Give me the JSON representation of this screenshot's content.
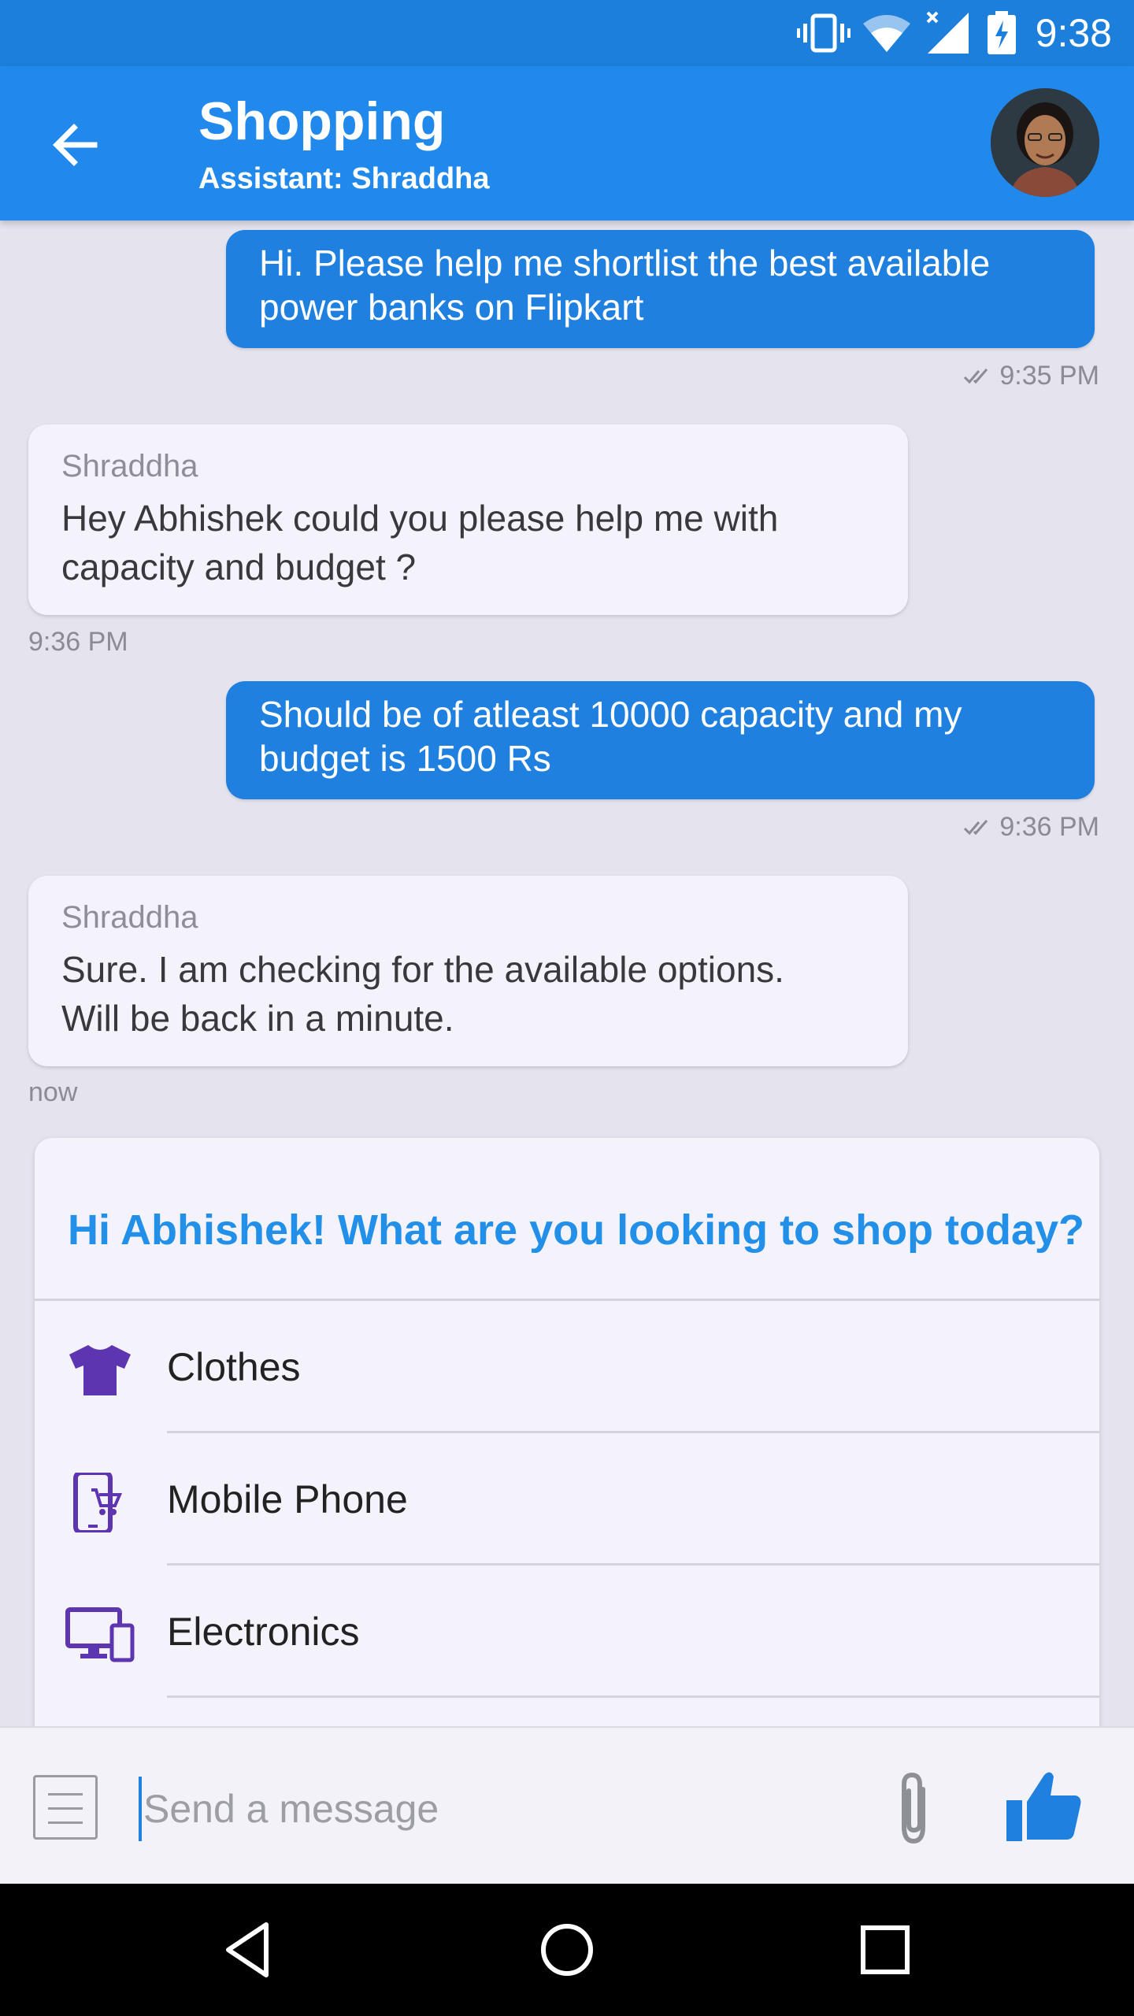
{
  "status_bar": {
    "time": "9:38",
    "icons": [
      "vibrate-icon",
      "wifi-icon",
      "signal-icon",
      "battery-charging-icon"
    ]
  },
  "app_bar": {
    "title": "Shopping",
    "subtitle": "Assistant: Shraddha",
    "back_icon": "arrow-back-icon",
    "avatar": "assistant-avatar"
  },
  "messages": [
    {
      "direction": "outgoing",
      "lines": [
        "Hi. Please help me shortlist the best available",
        "power banks on Flipkart"
      ],
      "time": "9:35 PM",
      "status_icon": "double-check-icon"
    },
    {
      "direction": "incoming",
      "sender": "Shraddha",
      "lines": [
        "Hey Abhishek could you please help me with",
        "capacity and budget ?"
      ],
      "time": "9:36 PM"
    },
    {
      "direction": "outgoing",
      "lines": [
        "Should be of atleast 10000 capacity and my",
        "budget is 1500 Rs"
      ],
      "time": "9:36 PM",
      "status_icon": "double-check-icon"
    },
    {
      "direction": "incoming",
      "sender": "Shraddha",
      "lines": [
        "Sure. I am checking for the available options.",
        "Will be back in a minute."
      ],
      "time": "now"
    }
  ],
  "shop_card": {
    "title": "Hi Abhishek! What are you looking to shop today?",
    "options": [
      {
        "label": "Clothes",
        "icon": "tshirt-icon"
      },
      {
        "label": "Mobile Phone",
        "icon": "mobile-cart-icon"
      },
      {
        "label": "Electronics",
        "icon": "devices-icon"
      }
    ]
  },
  "input_bar": {
    "placeholder": "Send a message",
    "value": ""
  },
  "colors": {
    "status_bar": "#1b7fdb",
    "app_bar": "#2289ec",
    "outgoing_bubble": "#1f80e0",
    "incoming_bubble": "#f4f3fb",
    "card_title": "#2290e8",
    "option_icon": "#5e35b1"
  },
  "nav_bar": [
    "back-nav-icon",
    "home-nav-icon",
    "recents-nav-icon"
  ]
}
